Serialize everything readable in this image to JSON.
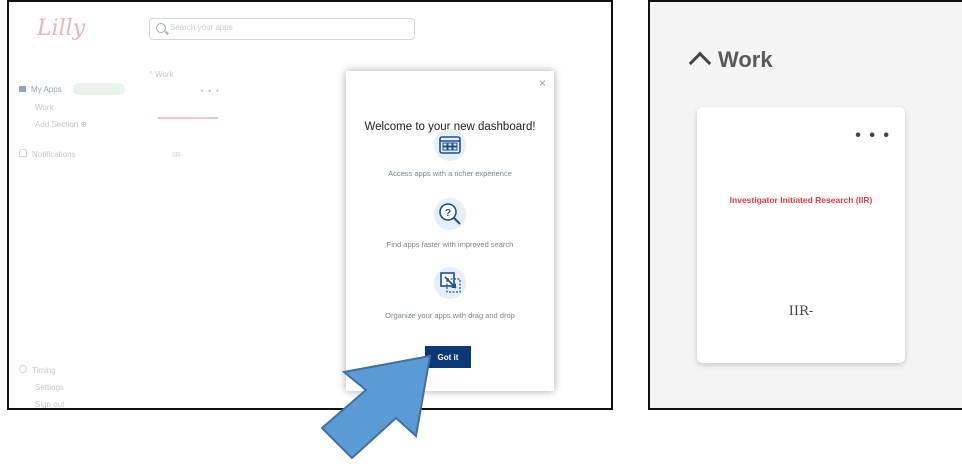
{
  "dashboard": {
    "logo_text": "Lilly",
    "search_placeholder": "Search your apps",
    "nav": {
      "my_apps": "My Apps",
      "work": "Work",
      "add_section": "Add Section ⊕",
      "notifications": "Notifications",
      "timing": "Timing",
      "settings": "Settings",
      "sign_out": "Sign out"
    },
    "section_label": "^ Work",
    "card": {
      "abbr": "IIR-"
    }
  },
  "modal": {
    "close": "×",
    "title": "Welcome to your new dashboard!",
    "features": [
      {
        "icon": "dashboard-grid-icon",
        "text": "Access apps with a richer experience"
      },
      {
        "icon": "search-question-icon",
        "text": "Find apps faster with improved search"
      },
      {
        "icon": "drag-drop-icon",
        "text": "Organize your apps with drag and drop"
      }
    ],
    "button_label": "Got it"
  },
  "zoom": {
    "section_title": "Work",
    "card": {
      "menu": "• • •",
      "app_name": "Investigator Initiated Research (IIR)",
      "abbr": "IIR-"
    }
  },
  "colors": {
    "button": "#0d3878",
    "app_name_red": "#e63b3b",
    "arrow_fill": "#5b9bd5",
    "arrow_stroke": "#41719c"
  }
}
